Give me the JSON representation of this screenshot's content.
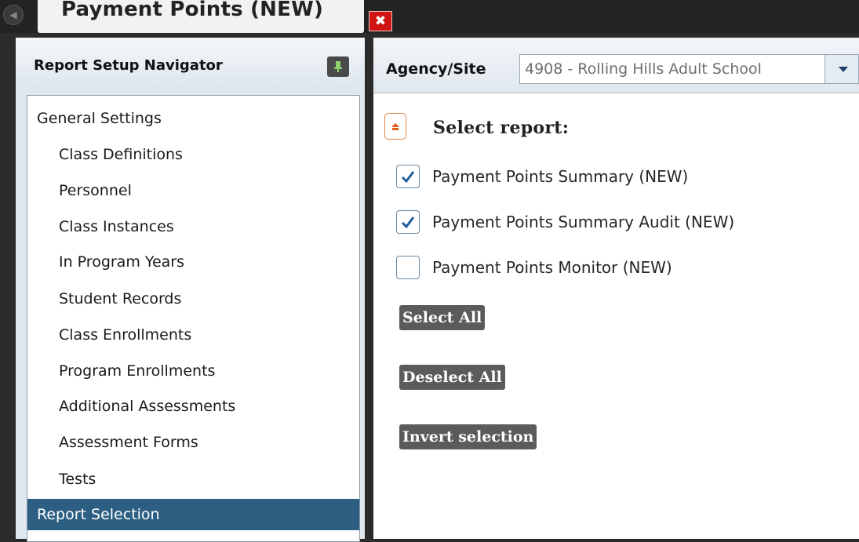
{
  "window": {
    "tab_title": "Payment Points (NEW)",
    "close_label": "✖"
  },
  "navigator": {
    "title": "Report Setup Navigator",
    "items": [
      {
        "label": "General Settings",
        "indent": 0,
        "selected": false
      },
      {
        "label": "Class Definitions",
        "indent": 1,
        "selected": false
      },
      {
        "label": "Personnel",
        "indent": 1,
        "selected": false
      },
      {
        "label": "Class Instances",
        "indent": 1,
        "selected": false
      },
      {
        "label": "In Program Years",
        "indent": 1,
        "selected": false
      },
      {
        "label": "Student Records",
        "indent": 1,
        "selected": false
      },
      {
        "label": "Class Enrollments",
        "indent": 1,
        "selected": false
      },
      {
        "label": "Program Enrollments",
        "indent": 1,
        "selected": false
      },
      {
        "label": "Additional Assessments",
        "indent": 1,
        "selected": false
      },
      {
        "label": "Assessment Forms",
        "indent": 1,
        "selected": false
      },
      {
        "label": "Tests",
        "indent": 1,
        "selected": false
      },
      {
        "label": "Report Selection",
        "indent": 0,
        "selected": true
      }
    ]
  },
  "agency": {
    "label": "Agency/Site",
    "value": "4908 - Rolling Hills Adult School"
  },
  "report_selection": {
    "title": "Select report:",
    "reports": [
      {
        "label": "Payment Points Summary (NEW)",
        "checked": true
      },
      {
        "label": "Payment Points Summary Audit (NEW)",
        "checked": true
      },
      {
        "label": "Payment Points Monitor (NEW)",
        "checked": false
      }
    ],
    "buttons": {
      "select_all": "Select All",
      "deselect_all": "Deselect All",
      "invert_selection": "Invert selection"
    }
  },
  "colors": {
    "selected_row": "#2d5f82",
    "close_button": "#d01414",
    "pin_icon": "#8fd16a",
    "checkmark": "#1f5f9c",
    "collapse_accent": "#e0874a",
    "action_button": "#5b5b5b"
  }
}
